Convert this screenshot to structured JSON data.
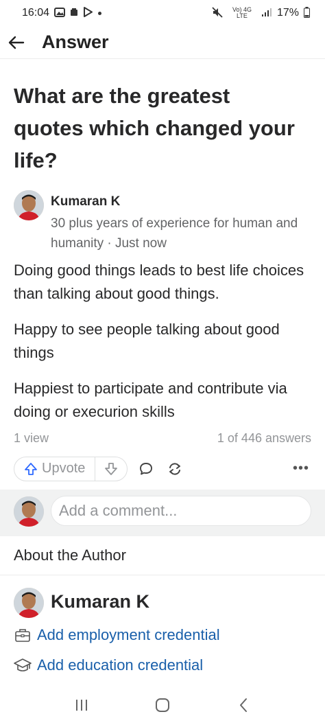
{
  "status_bar": {
    "time": "16:04",
    "network": "Vo) 4G LTE",
    "battery": "17%"
  },
  "header": {
    "title": "Answer"
  },
  "question": {
    "title": "What are the greatest quotes which changed your life?"
  },
  "answer": {
    "author_name": "Kumaran K",
    "author_credential": "30 plus years of experience for human and humanity · Just now",
    "paragraphs": [
      "Doing good things leads to best life choices than talking about good things.",
      "Happy to see people talking about good things",
      "Happiest to participate and contribute via doing or execurion skills"
    ],
    "views": "1 view",
    "answer_position": "1 of 446 answers"
  },
  "actions": {
    "upvote_label": "Upvote",
    "more_label": "•••"
  },
  "comment": {
    "placeholder": "Add a comment..."
  },
  "about": {
    "section_title": "About the Author",
    "author_name": "Kumaran K",
    "employment_link": "Add employment credential",
    "education_link": "Add education credential"
  },
  "colors": {
    "link_blue": "#195faa",
    "muted_gray": "#939598",
    "comment_bar_bg": "#f1f2f2"
  }
}
